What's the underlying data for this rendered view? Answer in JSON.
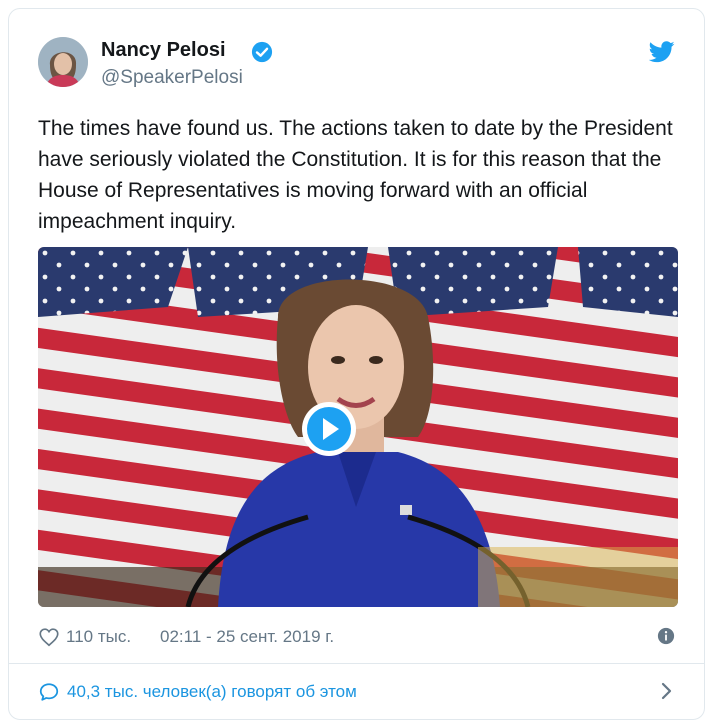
{
  "tweet": {
    "author_name": "Nancy Pelosi",
    "author_handle": "@SpeakerPelosi",
    "text": "The times have found us. The actions taken to date by the President have seriously violated the Constitution. It is for this reason that the House of Representatives is moving forward with an official impeachment inquiry.",
    "likes": "110 тыс.",
    "timestamp": "02:11 - 25 сент. 2019 г.",
    "conversation": "40,3 тыс. человек(а) говорят об этом"
  },
  "colors": {
    "accent": "#1da1f2",
    "link": "#1b95e0",
    "muted": "#657786",
    "text": "#14171a",
    "border": "#e1e8ed"
  },
  "icons": {
    "verified": "verified-badge-icon",
    "brand": "twitter-bird-icon",
    "like": "heart-icon",
    "info": "info-icon",
    "reply": "speech-bubble-icon",
    "more": "chevron-right-icon",
    "play": "play-icon"
  }
}
